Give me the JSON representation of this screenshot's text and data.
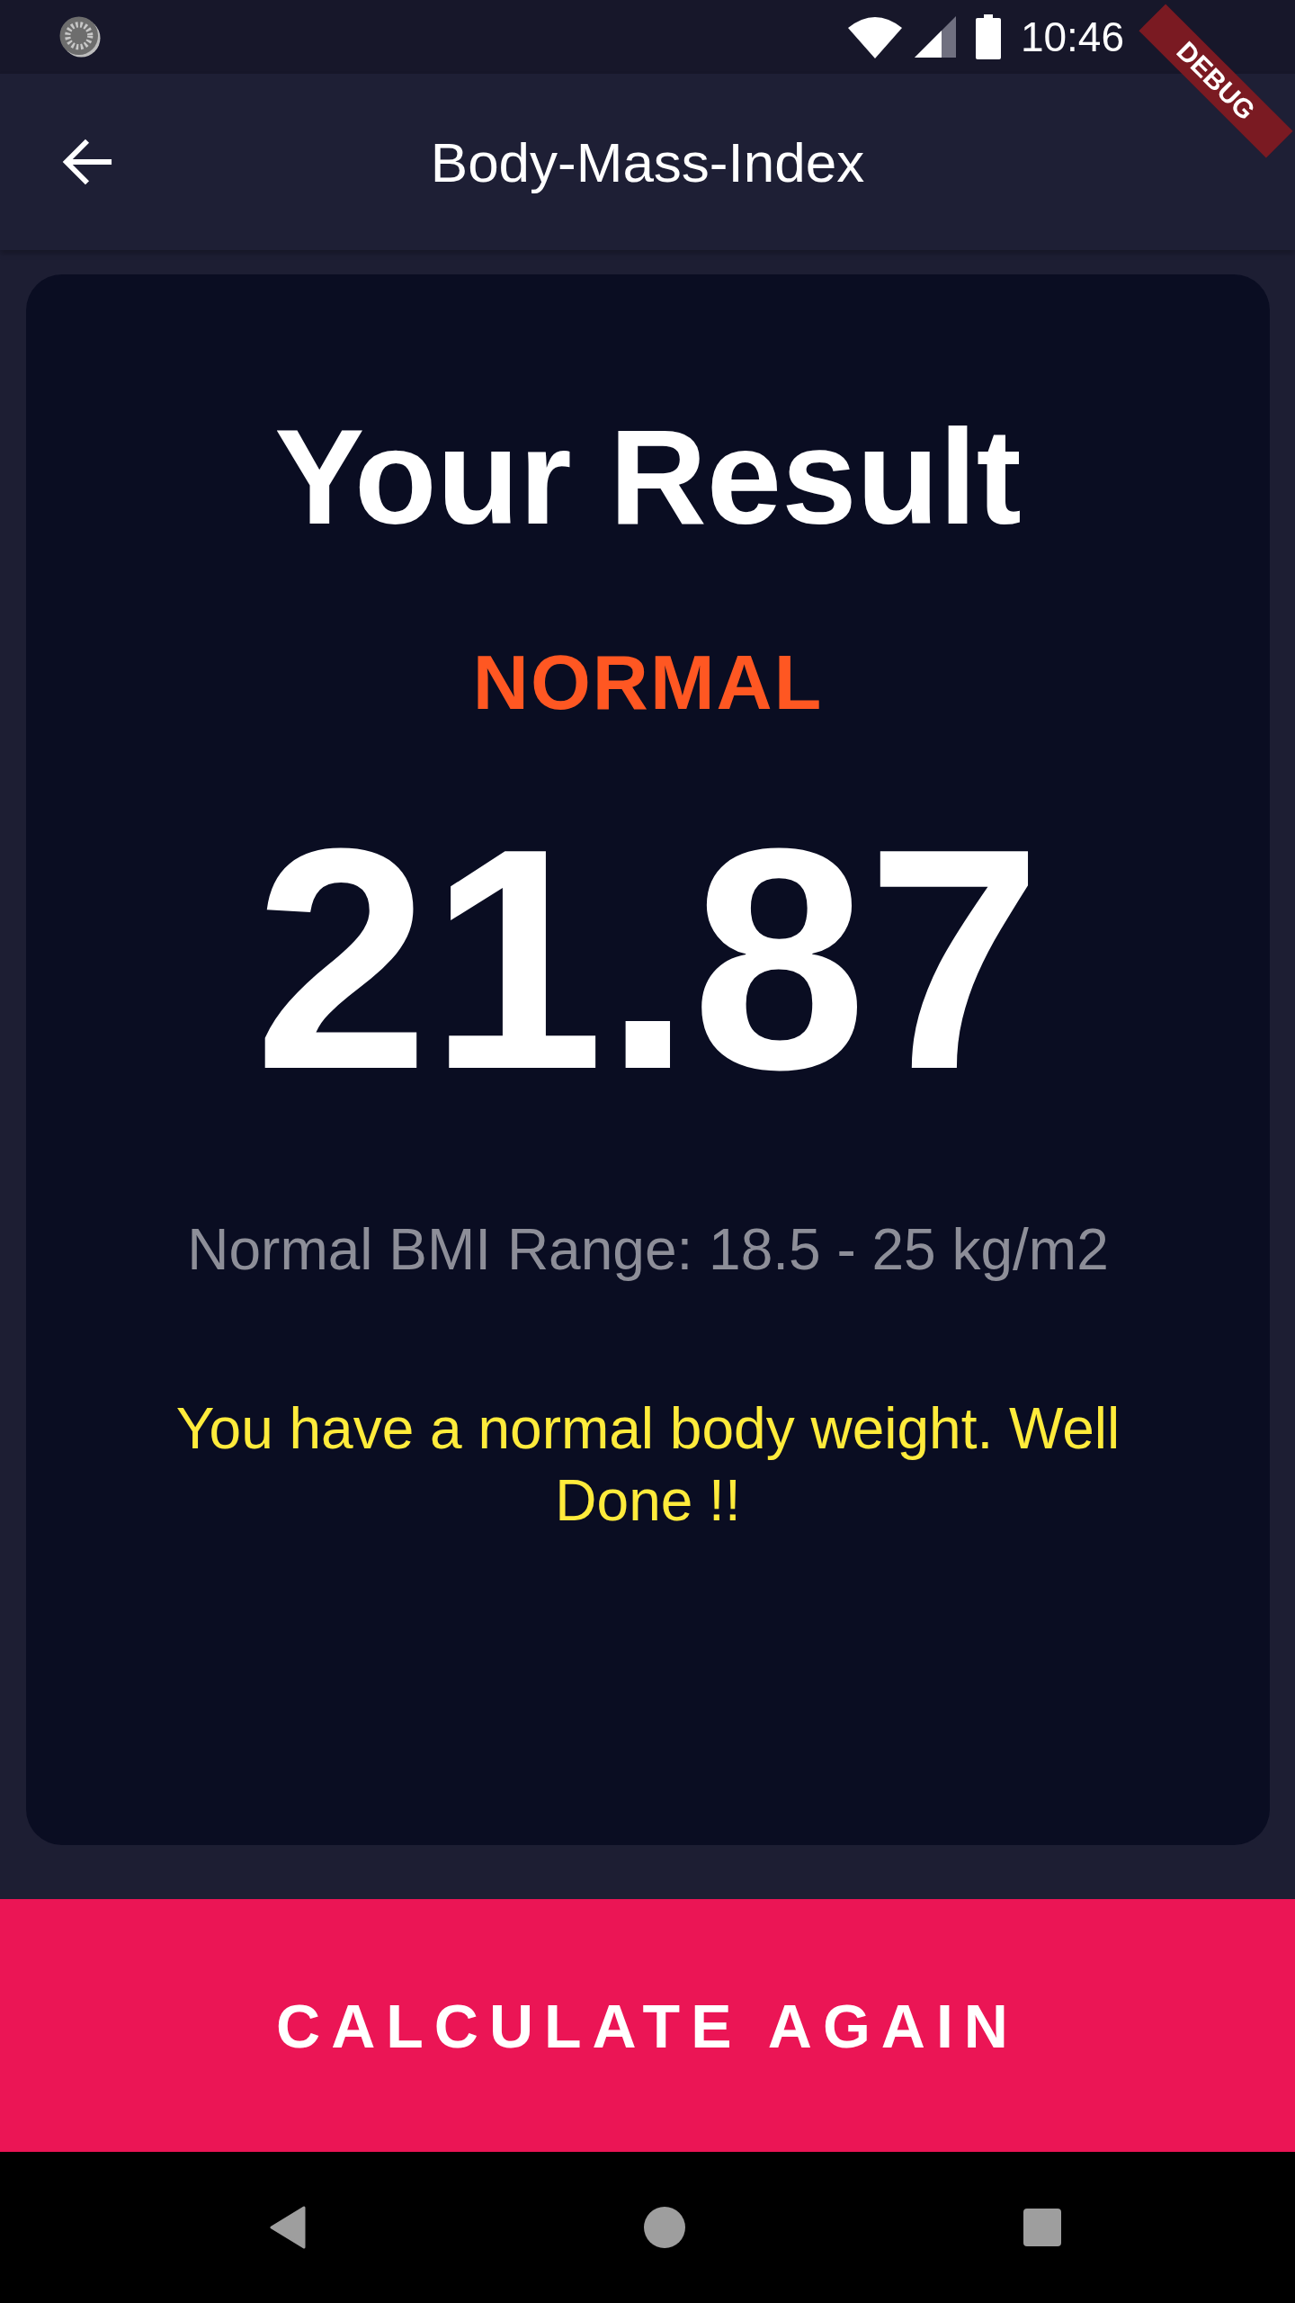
{
  "status_bar": {
    "time": "10:46"
  },
  "debug_banner": {
    "label": "DEBUG"
  },
  "app_bar": {
    "title": "Body-Mass-Index"
  },
  "result_card": {
    "heading": "Your Result",
    "category": "NORMAL",
    "bmi": "21.87",
    "range": "Normal BMI Range: 18.5 - 25 kg/m2",
    "message": "You have a normal body weight. Well Done !!"
  },
  "action_button": {
    "label": "CALCULATE AGAIN"
  }
}
